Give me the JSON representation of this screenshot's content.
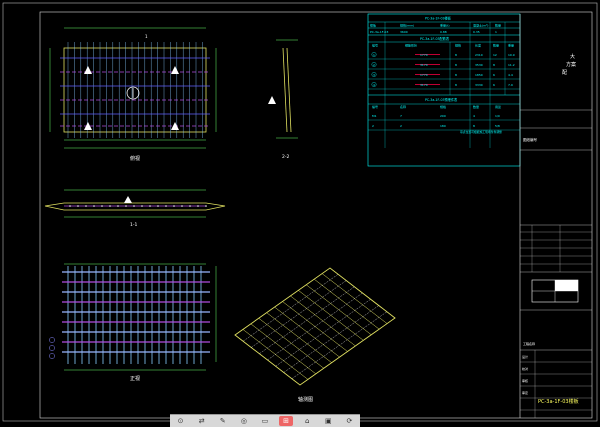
{
  "views": {
    "plan_label": "俯视",
    "elev_label": "正视",
    "side_label": "2-2",
    "section_label": "1-1",
    "iso_label": "轴测图",
    "mark_1": "1",
    "mark_2": "2"
  },
  "tables": {
    "t1": {
      "title": "PC-3a-1F-03楼板",
      "headers": [
        "楼板",
        "规格(mm)",
        "重量(t)",
        "混凝土(m³)",
        "数量"
      ],
      "row": [
        "PC-3a-1F-03",
        "3600",
        "0.88",
        "0.35",
        "1"
      ]
    },
    "t2": {
      "title": "PC-3a-1F-03配筋表",
      "headers": [
        "编号",
        "钢筋形状",
        "规格",
        "长度",
        "数量",
        "重量"
      ],
      "rows": [
        [
          "1",
          "1770",
          "8",
          "2310",
          "12",
          "10.9"
        ],
        [
          "2",
          "3170",
          "8",
          "3530",
          "8",
          "11.2"
        ],
        [
          "3",
          "1770",
          "8",
          "1850",
          "6",
          "4.4"
        ],
        [
          "4",
          "3170",
          "8",
          "3330",
          "6",
          "7.9"
        ]
      ]
    },
    "t3": {
      "title": "PC-3a-1F-03预埋件表",
      "headers": [
        "编号",
        "名称",
        "规格",
        "数量",
        "用途"
      ],
      "rows": [
        [
          "M1",
          "7",
          "200",
          "4",
          "1/0"
        ],
        [
          "2",
          "2",
          "180",
          "8",
          "5/8"
        ]
      ],
      "note": "吊点位置可根据施工现场条件调整"
    }
  },
  "title_block": {
    "company_lines": [
      "大",
      "方案",
      "配"
    ],
    "sheet_no": "图纸编号",
    "sign_rows": [
      "设计",
      "校对",
      "审核",
      "审定"
    ],
    "project": "工程名称",
    "drawing_title": "PC-3a-1F-03楼板"
  },
  "taskbar": {
    "items": [
      "⊙",
      "⇄",
      "✎",
      "◎",
      "▭",
      "⊞",
      "⌂",
      "▣",
      "⟳"
    ]
  }
}
